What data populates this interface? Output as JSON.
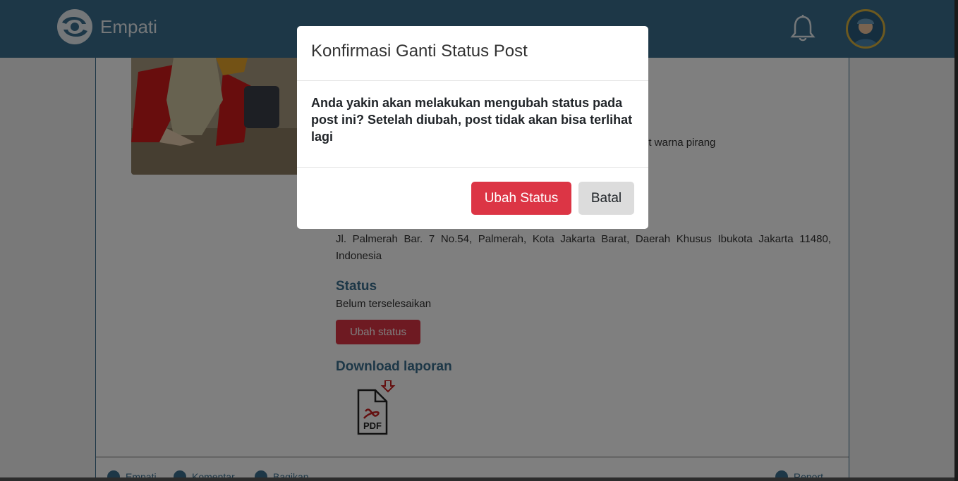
{
  "header": {
    "brand": "Empati",
    "logo_icon": "empati-logo-icon",
    "bell_icon": "bell-icon",
    "avatar": "user-avatar"
  },
  "post": {
    "description_tail": "ut warna pirang",
    "address": "Jl. Palmerah Bar. 7 No.54, Palmerah, Kota Jakarta Barat, Daerah Khusus Ibukota Jakarta 11480, Indonesia",
    "status_heading": "Status",
    "status_value": "Belum terselesaikan",
    "change_status_button": "Ubah status",
    "download_heading": "Download laporan",
    "pdf_label": "PDF"
  },
  "footer": {
    "empati": "Empati",
    "comment": "Komentar",
    "share": "Bagikan",
    "report": "Report"
  },
  "modal": {
    "title": "Konfirmasi Ganti Status Post",
    "body": "Anda yakin akan melakukan mengubah status pada post ini? Setelah diubah, post tidak akan bisa terlihat lagi",
    "confirm_button": "Ubah Status",
    "cancel_button": "Batal"
  },
  "colors": {
    "primary": "#3a6f8f",
    "danger": "#dc3545",
    "avatar_ring": "#d9b340"
  }
}
